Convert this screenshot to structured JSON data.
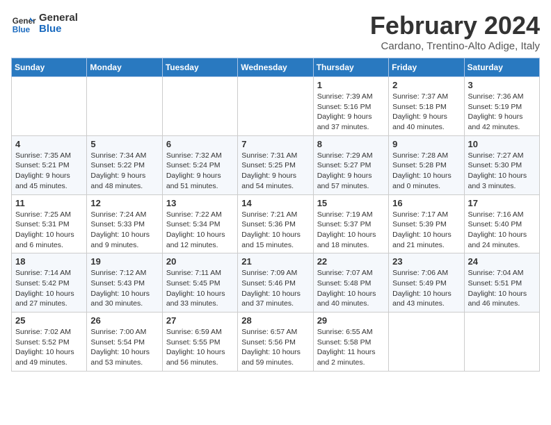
{
  "header": {
    "logo_line1": "General",
    "logo_line2": "Blue",
    "title": "February 2024",
    "subtitle": "Cardano, Trentino-Alto Adige, Italy"
  },
  "columns": [
    "Sunday",
    "Monday",
    "Tuesday",
    "Wednesday",
    "Thursday",
    "Friday",
    "Saturday"
  ],
  "weeks": [
    [
      {
        "day": "",
        "info": ""
      },
      {
        "day": "",
        "info": ""
      },
      {
        "day": "",
        "info": ""
      },
      {
        "day": "",
        "info": ""
      },
      {
        "day": "1",
        "info": "Sunrise: 7:39 AM\nSunset: 5:16 PM\nDaylight: 9 hours\nand 37 minutes."
      },
      {
        "day": "2",
        "info": "Sunrise: 7:37 AM\nSunset: 5:18 PM\nDaylight: 9 hours\nand 40 minutes."
      },
      {
        "day": "3",
        "info": "Sunrise: 7:36 AM\nSunset: 5:19 PM\nDaylight: 9 hours\nand 42 minutes."
      }
    ],
    [
      {
        "day": "4",
        "info": "Sunrise: 7:35 AM\nSunset: 5:21 PM\nDaylight: 9 hours\nand 45 minutes."
      },
      {
        "day": "5",
        "info": "Sunrise: 7:34 AM\nSunset: 5:22 PM\nDaylight: 9 hours\nand 48 minutes."
      },
      {
        "day": "6",
        "info": "Sunrise: 7:32 AM\nSunset: 5:24 PM\nDaylight: 9 hours\nand 51 minutes."
      },
      {
        "day": "7",
        "info": "Sunrise: 7:31 AM\nSunset: 5:25 PM\nDaylight: 9 hours\nand 54 minutes."
      },
      {
        "day": "8",
        "info": "Sunrise: 7:29 AM\nSunset: 5:27 PM\nDaylight: 9 hours\nand 57 minutes."
      },
      {
        "day": "9",
        "info": "Sunrise: 7:28 AM\nSunset: 5:28 PM\nDaylight: 10 hours\nand 0 minutes."
      },
      {
        "day": "10",
        "info": "Sunrise: 7:27 AM\nSunset: 5:30 PM\nDaylight: 10 hours\nand 3 minutes."
      }
    ],
    [
      {
        "day": "11",
        "info": "Sunrise: 7:25 AM\nSunset: 5:31 PM\nDaylight: 10 hours\nand 6 minutes."
      },
      {
        "day": "12",
        "info": "Sunrise: 7:24 AM\nSunset: 5:33 PM\nDaylight: 10 hours\nand 9 minutes."
      },
      {
        "day": "13",
        "info": "Sunrise: 7:22 AM\nSunset: 5:34 PM\nDaylight: 10 hours\nand 12 minutes."
      },
      {
        "day": "14",
        "info": "Sunrise: 7:21 AM\nSunset: 5:36 PM\nDaylight: 10 hours\nand 15 minutes."
      },
      {
        "day": "15",
        "info": "Sunrise: 7:19 AM\nSunset: 5:37 PM\nDaylight: 10 hours\nand 18 minutes."
      },
      {
        "day": "16",
        "info": "Sunrise: 7:17 AM\nSunset: 5:39 PM\nDaylight: 10 hours\nand 21 minutes."
      },
      {
        "day": "17",
        "info": "Sunrise: 7:16 AM\nSunset: 5:40 PM\nDaylight: 10 hours\nand 24 minutes."
      }
    ],
    [
      {
        "day": "18",
        "info": "Sunrise: 7:14 AM\nSunset: 5:42 PM\nDaylight: 10 hours\nand 27 minutes."
      },
      {
        "day": "19",
        "info": "Sunrise: 7:12 AM\nSunset: 5:43 PM\nDaylight: 10 hours\nand 30 minutes."
      },
      {
        "day": "20",
        "info": "Sunrise: 7:11 AM\nSunset: 5:45 PM\nDaylight: 10 hours\nand 33 minutes."
      },
      {
        "day": "21",
        "info": "Sunrise: 7:09 AM\nSunset: 5:46 PM\nDaylight: 10 hours\nand 37 minutes."
      },
      {
        "day": "22",
        "info": "Sunrise: 7:07 AM\nSunset: 5:48 PM\nDaylight: 10 hours\nand 40 minutes."
      },
      {
        "day": "23",
        "info": "Sunrise: 7:06 AM\nSunset: 5:49 PM\nDaylight: 10 hours\nand 43 minutes."
      },
      {
        "day": "24",
        "info": "Sunrise: 7:04 AM\nSunset: 5:51 PM\nDaylight: 10 hours\nand 46 minutes."
      }
    ],
    [
      {
        "day": "25",
        "info": "Sunrise: 7:02 AM\nSunset: 5:52 PM\nDaylight: 10 hours\nand 49 minutes."
      },
      {
        "day": "26",
        "info": "Sunrise: 7:00 AM\nSunset: 5:54 PM\nDaylight: 10 hours\nand 53 minutes."
      },
      {
        "day": "27",
        "info": "Sunrise: 6:59 AM\nSunset: 5:55 PM\nDaylight: 10 hours\nand 56 minutes."
      },
      {
        "day": "28",
        "info": "Sunrise: 6:57 AM\nSunset: 5:56 PM\nDaylight: 10 hours\nand 59 minutes."
      },
      {
        "day": "29",
        "info": "Sunrise: 6:55 AM\nSunset: 5:58 PM\nDaylight: 11 hours\nand 2 minutes."
      },
      {
        "day": "",
        "info": ""
      },
      {
        "day": "",
        "info": ""
      }
    ]
  ]
}
